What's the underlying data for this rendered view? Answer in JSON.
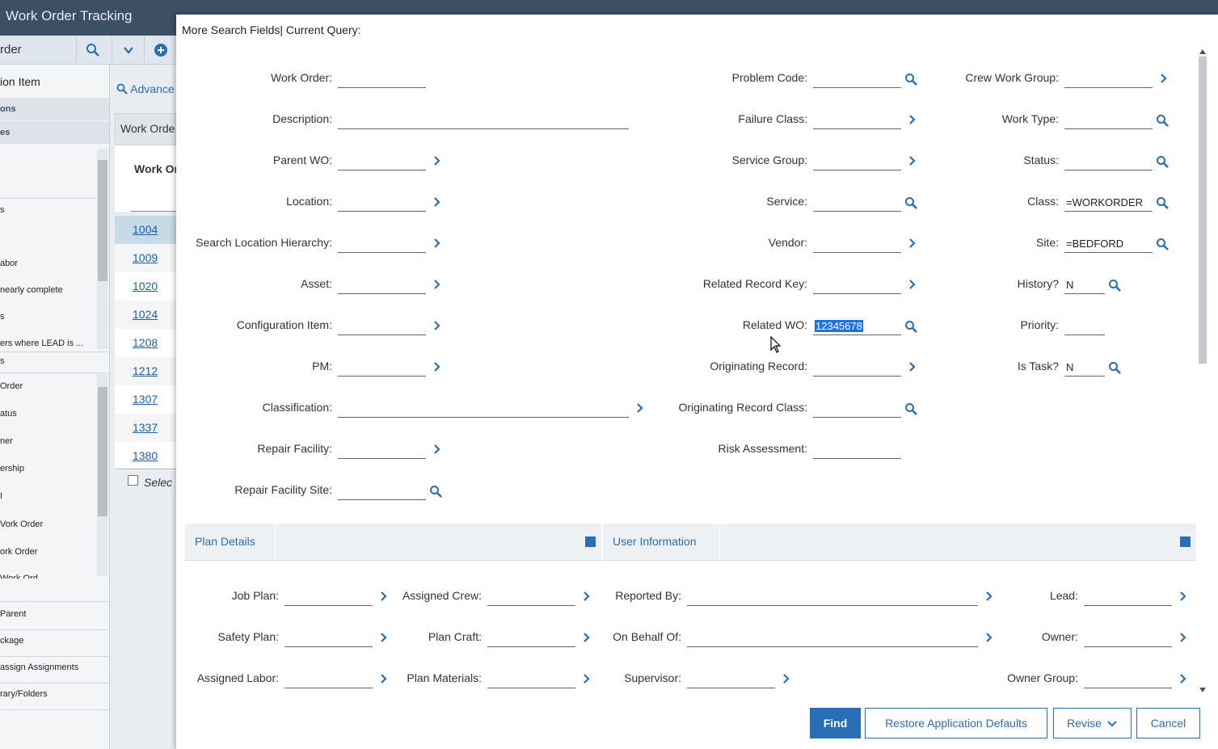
{
  "app": {
    "title": "Work Order Tracking",
    "search_text": "rder"
  },
  "left_panel": {
    "top_item": "ion Item",
    "headers": [
      "ons",
      "es"
    ],
    "items_a": [
      "s",
      "abor",
      "nearly complete",
      "s",
      "ers where LEAD is ..."
    ],
    "header_b": "s",
    "items_b": [
      "Order",
      "atus",
      "ner",
      "ership",
      "I",
      "Vork Order",
      "ork Order",
      "Work Ord..."
    ],
    "items_c": [
      "Parent",
      "ckage",
      "assign Assignments",
      "rary/Folders"
    ]
  },
  "mid_panel": {
    "advanced": "Advance",
    "tab": "Work Orde",
    "column_header": "Work Or",
    "work_orders": [
      "1004",
      "1009",
      "1020",
      "1024",
      "1208",
      "1212",
      "1307",
      "1337",
      "1380"
    ],
    "select_label": "Selec"
  },
  "dialog": {
    "title": "More Search Fields| Current Query:",
    "col1": [
      {
        "label": "Work Order:",
        "value": "",
        "icon": "none"
      },
      {
        "label": "Description:",
        "value": "",
        "icon": "none"
      },
      {
        "label": "Parent WO:",
        "value": "",
        "icon": "chevron-right-icon"
      },
      {
        "label": "Location:",
        "value": "",
        "icon": "chevron-right-icon"
      },
      {
        "label": "Search Location Hierarchy:",
        "value": "",
        "icon": "chevron-right-icon"
      },
      {
        "label": "Asset:",
        "value": "",
        "icon": "chevron-right-icon"
      },
      {
        "label": "Configuration Item:",
        "value": "",
        "icon": "chevron-right-icon"
      },
      {
        "label": "PM:",
        "value": "",
        "icon": "chevron-right-icon"
      },
      {
        "label": "Classification:",
        "value": "",
        "icon": "chevron-right-icon"
      },
      {
        "label": "Repair Facility:",
        "value": "",
        "icon": "chevron-right-icon"
      },
      {
        "label": "Repair Facility Site:",
        "value": "",
        "icon": "search-icon"
      }
    ],
    "col2": [
      {
        "label": "Problem Code:",
        "value": "",
        "icon": "search-icon"
      },
      {
        "label": "Failure Class:",
        "value": "",
        "icon": "chevron-right-icon"
      },
      {
        "label": "Service Group:",
        "value": "",
        "icon": "chevron-right-icon"
      },
      {
        "label": "Service:",
        "value": "",
        "icon": "search-icon"
      },
      {
        "label": "Vendor:",
        "value": "",
        "icon": "chevron-right-icon"
      },
      {
        "label": "Related Record Key:",
        "value": "",
        "icon": "chevron-right-icon"
      },
      {
        "label": "Related WO:",
        "value": "12345678",
        "icon": "search-icon"
      },
      {
        "label": "Originating Record:",
        "value": "",
        "icon": "chevron-right-icon"
      },
      {
        "label": "Originating Record Class:",
        "value": "",
        "icon": "search-icon"
      },
      {
        "label": "Risk Assessment:",
        "value": "",
        "icon": "none"
      }
    ],
    "col3": [
      {
        "label": "Crew Work Group:",
        "value": "",
        "icon": "chevron-right-icon"
      },
      {
        "label": "Work Type:",
        "value": "",
        "icon": "search-icon"
      },
      {
        "label": "Status:",
        "value": "",
        "icon": "search-icon"
      },
      {
        "label": "Class:",
        "value": "=WORKORDER",
        "icon": "search-icon"
      },
      {
        "label": "Site:",
        "value": "=BEDFORD",
        "icon": "search-icon"
      },
      {
        "label": "History?",
        "value": "N",
        "icon": "search-icon"
      },
      {
        "label": "Priority:",
        "value": "",
        "icon": "none"
      },
      {
        "label": "Is Task?",
        "value": "N",
        "icon": "search-icon"
      }
    ],
    "sections": {
      "plan_details": "Plan Details",
      "user_information": "User Information"
    },
    "plan_fields": [
      {
        "label": "Job Plan:",
        "value": ""
      },
      {
        "label": "Safety Plan:",
        "value": ""
      },
      {
        "label": "Assigned Labor:",
        "value": ""
      },
      {
        "label": "Assigned Crew:",
        "value": ""
      },
      {
        "label": "Plan Craft:",
        "value": ""
      },
      {
        "label": "Plan Materials:",
        "value": ""
      }
    ],
    "user_fields": [
      {
        "label": "Reported By:",
        "value": ""
      },
      {
        "label": "On Behalf Of:",
        "value": ""
      },
      {
        "label": "Supervisor:",
        "value": ""
      },
      {
        "label": "Lead:",
        "value": ""
      },
      {
        "label": "Owner:",
        "value": ""
      },
      {
        "label": "Owner Group:",
        "value": ""
      }
    ],
    "buttons": {
      "find": "Find",
      "restore": "Restore Application Defaults",
      "revise": "Revise",
      "cancel": "Cancel"
    }
  },
  "colors": {
    "accent": "#2a6eb5",
    "topbar": "#3c4f63",
    "selection": "#1a73e8"
  }
}
